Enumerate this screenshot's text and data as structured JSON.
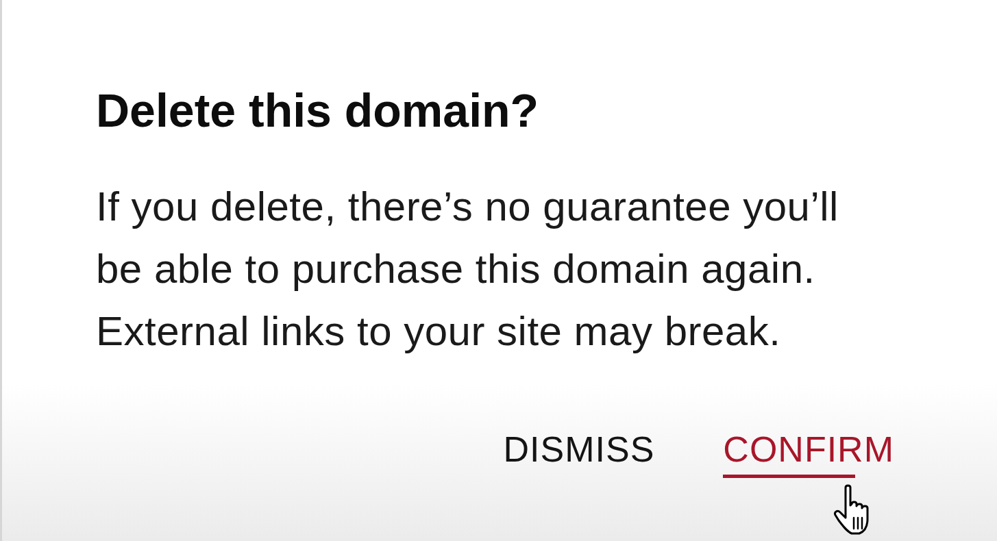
{
  "dialog": {
    "title": "Delete this domain?",
    "message": "If you delete, there’s no guarantee you’ll be able to purchase this domain again. External links to your site may break.",
    "buttons": [
      {
        "label": "DISMISS",
        "kind": "secondary",
        "hovered": false
      },
      {
        "label": "CONFIRM",
        "kind": "primary",
        "hovered": true
      }
    ]
  }
}
